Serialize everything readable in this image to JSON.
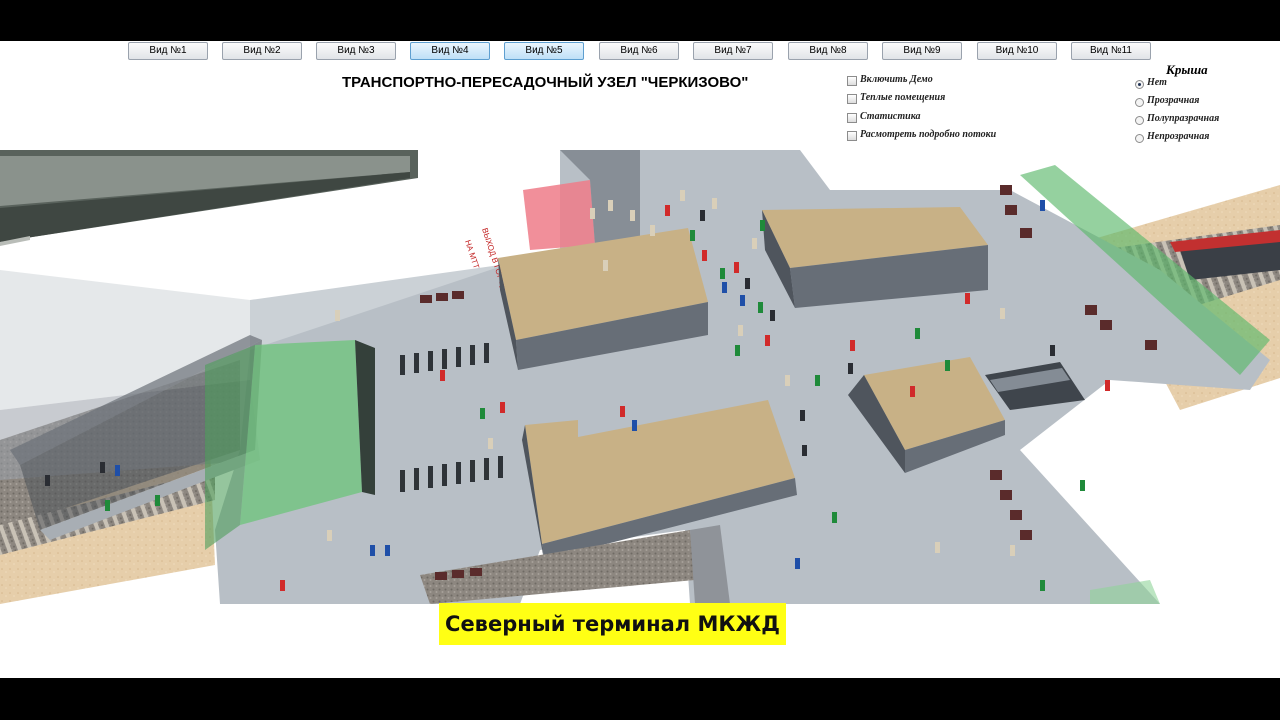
{
  "views": [
    "Вид №1",
    "Вид №2",
    "Вид №3",
    "Вид №4",
    "Вид №5",
    "Вид №6",
    "Вид №7",
    "Вид №8",
    "Вид №9",
    "Вид №10",
    "Вид №11"
  ],
  "title": "ТРАНСПОРТНО-ПЕРЕСАДОЧНЫЙ УЗЕЛ \"ЧЕРКИЗОВО\"",
  "options": [
    {
      "label": "Включить Демо",
      "checked": false
    },
    {
      "label": "Теплые помещения",
      "checked": false
    },
    {
      "label": "Статистика",
      "checked": false
    },
    {
      "label": "Расмотреть подробно потоки",
      "checked": false
    }
  ],
  "roof": {
    "title": "Крыша",
    "options": [
      {
        "label": "Нет",
        "selected": true
      },
      {
        "label": "Прозрачная",
        "selected": false
      },
      {
        "label": "Полупразрачная",
        "selected": false
      },
      {
        "label": "Непрозрачная",
        "selected": false
      }
    ]
  },
  "scene_sign": {
    "line1": "ВЫХОД В ГОРОД",
    "line2": "НА МТТ"
  },
  "caption": "Северный терминал МКЖД",
  "colors": {
    "caption_bg": "#ffff14",
    "floor": "#b8bfc6",
    "roof_block": "#c8b186",
    "glass_green": "#6cc47a",
    "exit_red": "#ef7b88"
  }
}
